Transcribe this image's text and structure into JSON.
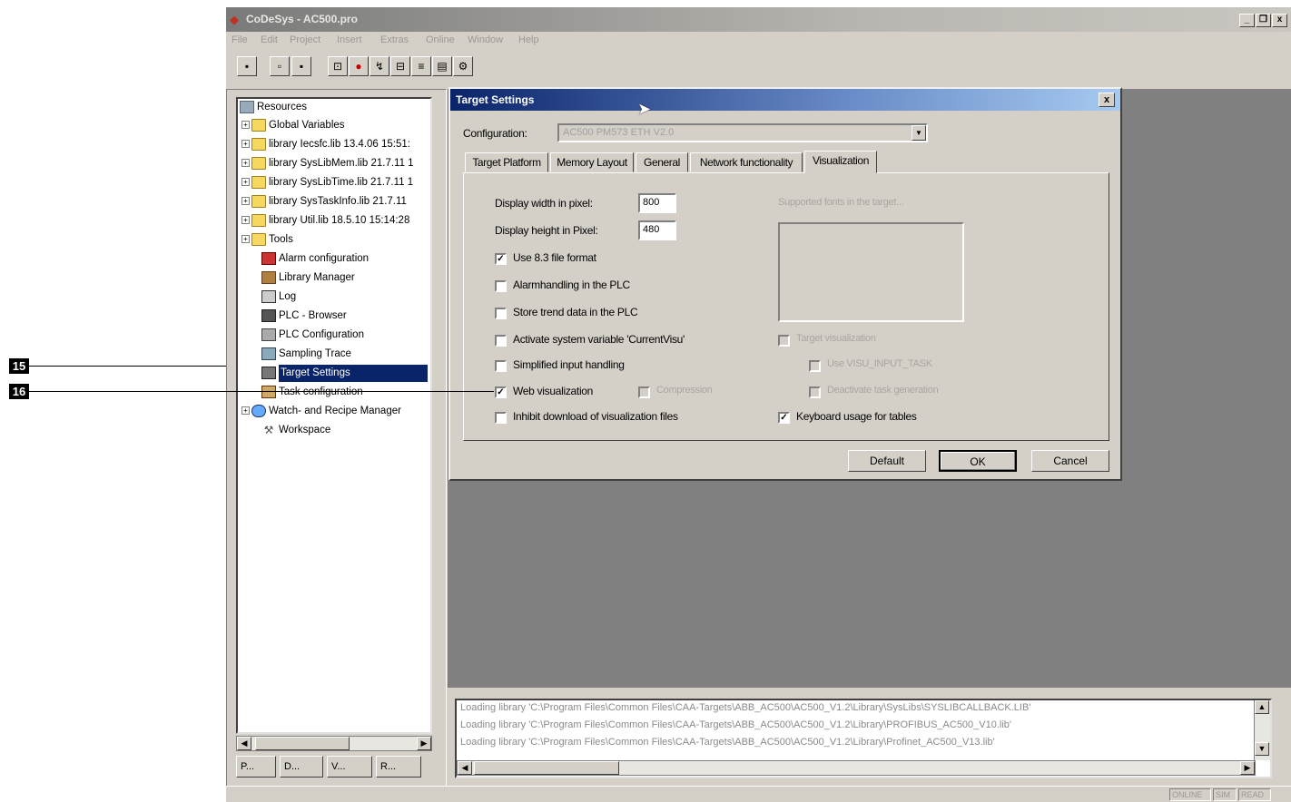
{
  "callouts": [
    "15",
    "16"
  ],
  "app": {
    "title": "CoDeSys - AC500.pro",
    "window_controls": [
      "_",
      "×",
      "x"
    ],
    "menu": [
      "File",
      "Edit",
      "Project",
      "Insert",
      "Extras",
      "Online",
      "Window",
      "Help"
    ]
  },
  "toolbar_icons": [
    "save-icon",
    "save-all-icon",
    "login-icon",
    "stop-icon",
    "run-icon",
    "step-icon",
    "breakpoint-icon",
    "monitor-icon",
    "config-icon"
  ],
  "tree": {
    "root": "Resources",
    "items": [
      {
        "label": "Global Variables",
        "icon": "folder-icon",
        "expandable": true
      },
      {
        "label": "library Iecsfc.lib 13.4.06 15:51:",
        "icon": "folder-icon",
        "expandable": true
      },
      {
        "label": "library SysLibMem.lib 21.7.11 1",
        "icon": "folder-icon",
        "expandable": true
      },
      {
        "label": "library SysLibTime.lib 21.7.11 1",
        "icon": "folder-icon",
        "expandable": true
      },
      {
        "label": "library SysTaskInfo.lib 21.7.11",
        "icon": "folder-icon",
        "expandable": true
      },
      {
        "label": "library Util.lib 18.5.10 15:14:28",
        "icon": "folder-icon",
        "expandable": true
      },
      {
        "label": "Tools",
        "icon": "tools-folder-icon",
        "expandable": true
      },
      {
        "label": "Alarm configuration",
        "icon": "alarm-icon",
        "expandable": false
      },
      {
        "label": "Library Manager",
        "icon": "library-icon",
        "expandable": false
      },
      {
        "label": "Log",
        "icon": "log-icon",
        "expandable": false
      },
      {
        "label": "PLC - Browser",
        "icon": "browser-icon",
        "expandable": false
      },
      {
        "label": "PLC Configuration",
        "icon": "plc-config-icon",
        "expandable": false
      },
      {
        "label": "Sampling Trace",
        "icon": "trace-icon",
        "expandable": false
      },
      {
        "label": "Target Settings",
        "icon": "target-icon",
        "expandable": false,
        "selected": true
      },
      {
        "label": "Task configuration",
        "icon": "task-icon",
        "expandable": false
      },
      {
        "label": "Watch- and Recipe Manager",
        "icon": "watch-icon",
        "expandable": true
      },
      {
        "label": "Workspace",
        "icon": "workspace-icon",
        "expandable": false
      }
    ],
    "bottom_tabs": [
      "P...",
      "D...",
      "V...",
      "R..."
    ]
  },
  "dialog": {
    "title": "Target Settings",
    "close": "x",
    "configuration_label": "Configuration:",
    "configuration_value": "AC500 PM573 ETH V2.0",
    "tabs": [
      "Target Platform",
      "Memory Layout",
      "General",
      "Network functionality",
      "Visualization"
    ],
    "active_tab": "Visualization",
    "width_label": "Display width in pixel:",
    "width_value": "800",
    "height_label": "Display height in Pixel:",
    "height_value": "480",
    "supported_fonts_label": "Supported fonts in the target...",
    "options": [
      {
        "label": "Use 8.3 file format",
        "checked": true,
        "enabled": true
      },
      {
        "label": "Alarmhandling in the PLC",
        "checked": false,
        "enabled": true
      },
      {
        "label": "Store trend data in the PLC",
        "checked": false,
        "enabled": true
      },
      {
        "label": "Activate system variable 'CurrentVisu'",
        "checked": false,
        "enabled": true
      },
      {
        "label": "Simplified input handling",
        "checked": false,
        "enabled": true
      },
      {
        "label": "Web visualization",
        "checked": true,
        "enabled": true
      },
      {
        "label": "Inhibit download of visualization files",
        "checked": false,
        "enabled": true
      }
    ],
    "compression": {
      "label": "Compression",
      "checked": false,
      "enabled": false
    },
    "right_options": [
      {
        "label": "Target visualization",
        "checked": false,
        "enabled": false
      },
      {
        "label": "Use VISU_INPUT_TASK",
        "checked": false,
        "enabled": false
      },
      {
        "label": "Deactivate task generation",
        "checked": false,
        "enabled": false
      },
      {
        "label": "Keyboard usage for tables",
        "checked": true,
        "enabled": true
      }
    ],
    "buttons": {
      "default": "Default",
      "ok": "OK",
      "cancel": "Cancel"
    }
  },
  "messages": [
    "Loading library 'C:\\Program Files\\Common Files\\CAA-Targets\\ABB_AC500\\AC500_V1.2\\Library\\SysLibs\\SYSLIBCALLBACK.LIB'",
    "Loading library 'C:\\Program Files\\Common Files\\CAA-Targets\\ABB_AC500\\AC500_V1.2\\Library\\PROFIBUS_AC500_V10.lib'",
    "Loading library 'C:\\Program Files\\Common Files\\CAA-Targets\\ABB_AC500\\AC500_V1.2\\Library\\Profinet_AC500_V13.lib'"
  ],
  "status": [
    "ONLINE",
    "SIM",
    "READ"
  ]
}
